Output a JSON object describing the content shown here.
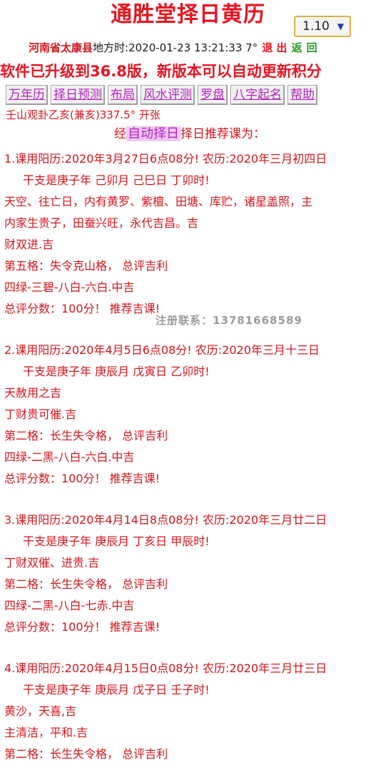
{
  "header": {
    "title": "通胜堂择日黄历",
    "version_selected": "1.10",
    "location": "河南省太康县",
    "time_text": "地方时:2020-01-23 13:21:33 7°",
    "exit_label": "退 出",
    "back_label": "返",
    "more_label": "回",
    "banner": "软件已升级到36.8版，新版本可以自动更新积分"
  },
  "nav": {
    "items": [
      "万年历",
      "择日预测",
      "布局",
      "风水评测",
      "罗盘",
      "八字起名",
      "帮助"
    ]
  },
  "content": {
    "mountain": "壬山观卦乙亥(兼亥)337.5° 开张",
    "subtitle_pre": "经",
    "subtitle_link": "自动择日",
    "subtitle_post": "择日推荐课为："
  },
  "results": [
    {
      "header": "1.课用阳历:2020年3月27日6点08分! 农历:2020年三月初四日",
      "ganzhi": "干支是庚子年 己卯月 己巳日 丁卯时!",
      "notes": [
        "天空、往亡日，内有黄罗、紫檀、田塘、库贮，诸星盖照，主",
        "内家生贵子，田蚕兴旺，永代吉昌。吉",
        "财双进.吉"
      ],
      "grade": "第五格：失令克山格，  总评吉利",
      "star": "四绿-三碧-八白-六白.中吉",
      "score": "总评分数：100分！ 推荐吉课!"
    },
    {
      "header": "2.课用阳历:2020年4月5日6点08分! 农历:2020年三月十三日",
      "ganzhi": "干支是庚子年 庚辰月 戊寅日 乙卯时!",
      "notes": [
        "天赦用之吉",
        "丁财贵可催.吉"
      ],
      "grade": "第二格：长生失令格，  总评吉利",
      "star": "四绿-二黑-八白-六白.中吉",
      "score": "总评分数：100分！ 推荐吉课!"
    },
    {
      "header": "3.课用阳历:2020年4月14日8点08分! 农历:2020年三月廿二日",
      "ganzhi": "干支是庚子年 庚辰月 丁亥日 甲辰时!",
      "notes": [
        "丁财双催、进贵.吉"
      ],
      "grade": "第二格：长生失令格，  总评吉利",
      "star": "四绿-二黑-八白-七赤.中吉",
      "score": "总评分数：100分！ 推荐吉课!"
    },
    {
      "header": "4.课用阳历:2020年4月15日0点08分! 农历:2020年三月廿三日",
      "ganzhi": "干支是庚子年 庚辰月 戊子日 壬子时!",
      "notes": [
        "黄沙，天喜,吉",
        "主清洁，平和.吉"
      ],
      "grade": "第二格：长生失令格，  总评吉利"
    }
  ],
  "watermark": "注册联系：13781668589"
}
